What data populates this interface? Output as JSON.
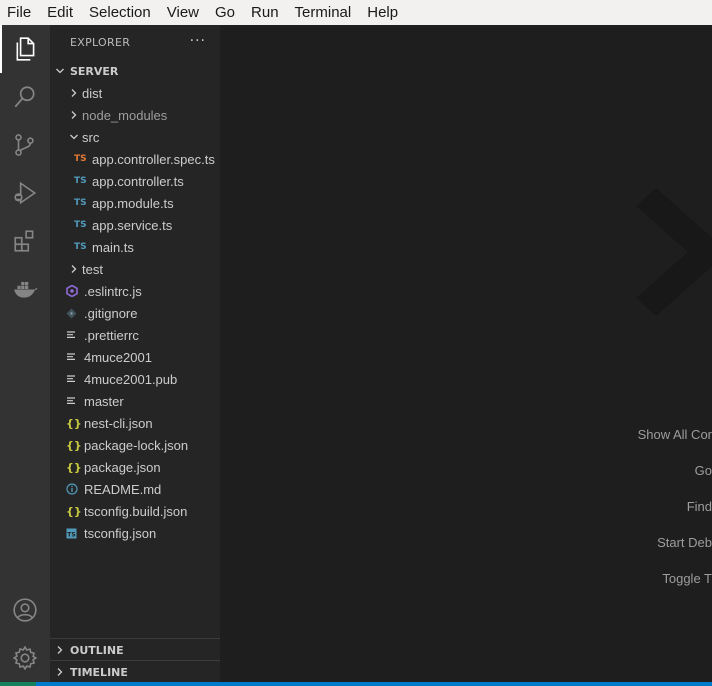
{
  "menubar": {
    "items": [
      "File",
      "Edit",
      "Selection",
      "View",
      "Go",
      "Run",
      "Terminal",
      "Help"
    ]
  },
  "activitybar": {
    "items": [
      {
        "name": "explorer-icon",
        "active": true
      },
      {
        "name": "search-icon"
      },
      {
        "name": "source-control-icon"
      },
      {
        "name": "run-debug-icon"
      },
      {
        "name": "extensions-icon"
      },
      {
        "name": "docker-icon"
      }
    ],
    "bottom": [
      {
        "name": "accounts-icon"
      },
      {
        "name": "settings-gear-icon"
      }
    ]
  },
  "sidebar": {
    "title": "EXPLORER",
    "more": "···",
    "root": "SERVER",
    "tree": [
      {
        "label": "dist",
        "type": "folder"
      },
      {
        "label": "node_modules",
        "type": "folder"
      },
      {
        "label": "src",
        "type": "folder-open"
      },
      {
        "label": "app.controller.spec.ts",
        "type": "ts-spec"
      },
      {
        "label": "app.controller.ts",
        "type": "ts"
      },
      {
        "label": "app.module.ts",
        "type": "ts"
      },
      {
        "label": "app.service.ts",
        "type": "ts"
      },
      {
        "label": "main.ts",
        "type": "ts"
      },
      {
        "label": "test",
        "type": "folder"
      },
      {
        "label": ".eslintrc.js",
        "type": "eslint"
      },
      {
        "label": ".gitignore",
        "type": "git"
      },
      {
        "label": ".prettierrc",
        "type": "text"
      },
      {
        "label": "4muce2001",
        "type": "text"
      },
      {
        "label": "4muce2001.pub",
        "type": "text"
      },
      {
        "label": "master",
        "type": "text"
      },
      {
        "label": "nest-cli.json",
        "type": "json"
      },
      {
        "label": "package-lock.json",
        "type": "json"
      },
      {
        "label": "package.json",
        "type": "json"
      },
      {
        "label": "README.md",
        "type": "info"
      },
      {
        "label": "tsconfig.build.json",
        "type": "json"
      },
      {
        "label": "tsconfig.json",
        "type": "tsconfig"
      }
    ],
    "outline": "OUTLINE",
    "timeline": "TIMELINE"
  },
  "editor": {
    "hints": [
      "Show All Cor",
      "Go",
      "Find",
      "Start Deb",
      "Toggle T"
    ]
  },
  "colors": {
    "accent": "#007acc",
    "ts": "#519aba",
    "ts_spec": "#e37933",
    "json": "#cbcb41",
    "eslint": "#8f6ad8"
  }
}
